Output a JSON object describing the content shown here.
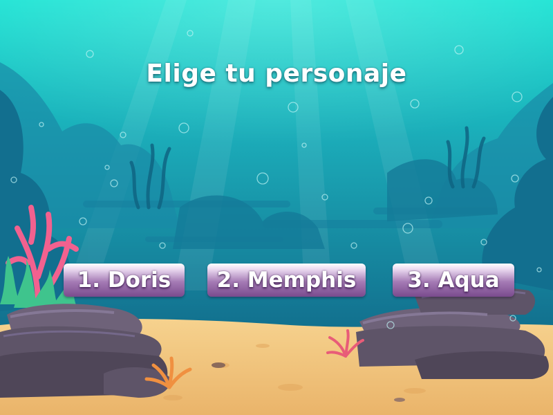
{
  "title": "Elige tu personaje",
  "choices": [
    {
      "label": "1. Doris"
    },
    {
      "label": "2. Memphis"
    },
    {
      "label": "3. Aqua"
    }
  ],
  "colors": {
    "water_top": "#2fd6cf",
    "water_bottom": "#0d5a7a",
    "sand": "#f3c57d",
    "rock": "#5e5468",
    "button": "#9a6aad"
  }
}
